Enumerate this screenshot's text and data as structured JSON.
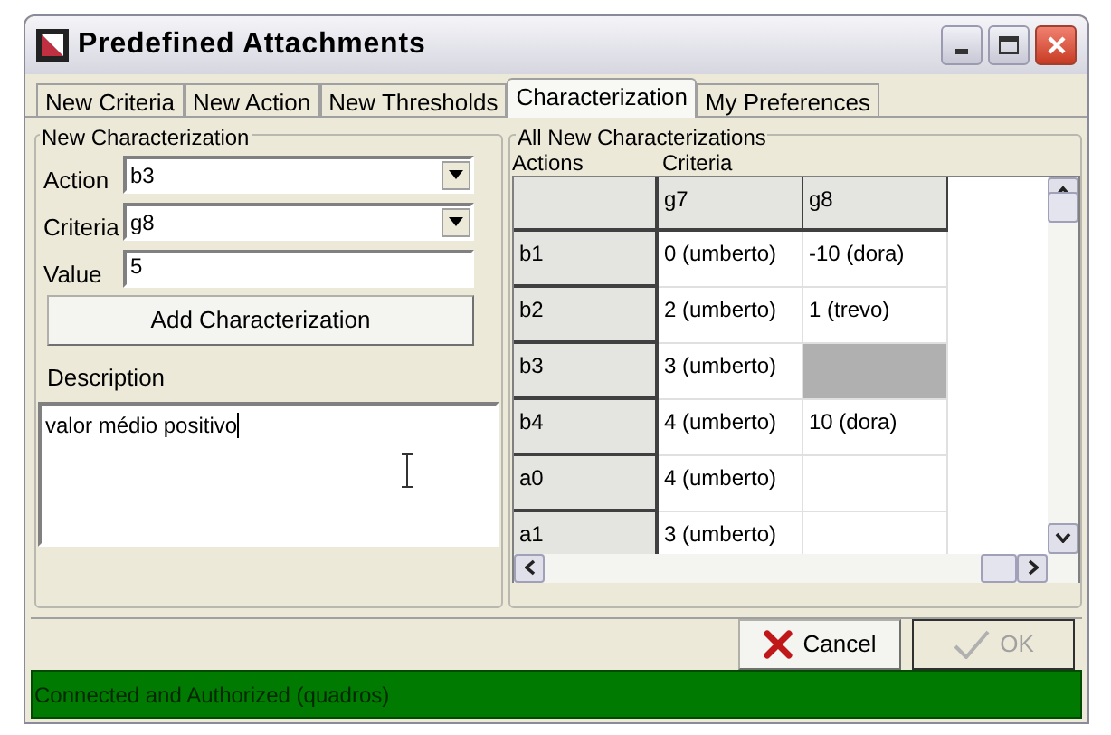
{
  "window": {
    "title": "Predefined Attachments"
  },
  "tabs": [
    {
      "label": "New Criteria",
      "selected": false
    },
    {
      "label": "New Action",
      "selected": false
    },
    {
      "label": "New Thresholds",
      "selected": false
    },
    {
      "label": "Characterization",
      "selected": true
    },
    {
      "label": "My Preferences",
      "selected": false
    }
  ],
  "new_characterization": {
    "title": "New Characterization",
    "fields": [
      {
        "label": "Action",
        "value": "b3",
        "kind": "combo"
      },
      {
        "label": "Criteria",
        "value": "g8",
        "kind": "combo"
      },
      {
        "label": "Value",
        "value": "5",
        "kind": "text"
      }
    ],
    "add_button": "Add Characterization",
    "description_label": "Description",
    "description": "valor médio positivo"
  },
  "all_characterizations": {
    "title": "All New Characterizations",
    "actions_label": "Actions",
    "criteria_label": "Criteria",
    "columns": [
      "g7",
      "g8"
    ],
    "rows": [
      {
        "action": "b1",
        "cells": [
          {
            "value": "0 (umberto)",
            "selected": false
          },
          {
            "value": "-10 (dora)",
            "selected": false
          }
        ]
      },
      {
        "action": "b2",
        "cells": [
          {
            "value": "2 (umberto)",
            "selected": false
          },
          {
            "value": "1 (trevo)",
            "selected": false
          }
        ]
      },
      {
        "action": "b3",
        "cells": [
          {
            "value": "3 (umberto)",
            "selected": false
          },
          {
            "selected": true
          }
        ]
      },
      {
        "action": "b4",
        "cells": [
          {
            "value": "4 (umberto)",
            "selected": false
          },
          {
            "value": "10 (dora)",
            "selected": false
          }
        ]
      },
      {
        "action": "a0",
        "cells": [
          {
            "value": "4 (umberto)",
            "selected": false
          },
          {
            "selected": false
          }
        ]
      },
      {
        "action": "a1",
        "cells": [
          {
            "value": "3 (umberto)",
            "selected": false
          },
          {
            "selected": false
          }
        ]
      }
    ]
  },
  "buttons": [
    {
      "label": "Cancel",
      "kind": "cancel",
      "disabled": false
    },
    {
      "label": "OK",
      "kind": "ok",
      "disabled": true
    }
  ],
  "status_bar": "Connected and Authorized (quadros)"
}
